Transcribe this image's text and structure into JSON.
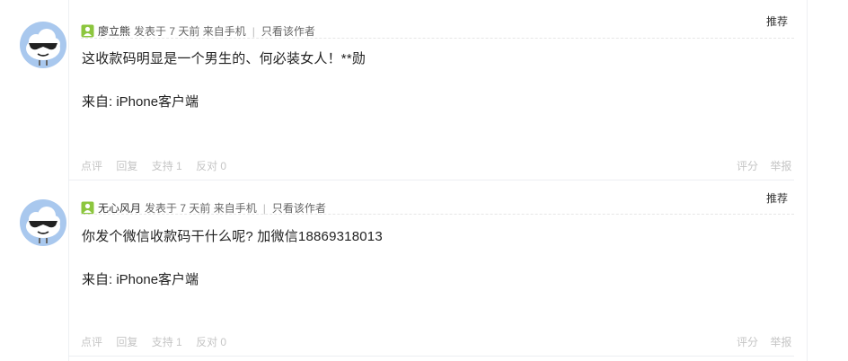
{
  "posts": [
    {
      "user": "廖立熊",
      "meta": "发表于 7 天前 来自手机",
      "only_author": "只看该作者",
      "badge": "推荐",
      "content": "这收款码明显是一个男生的、何必装女人！**勋",
      "from": "来自: iPhone客户端",
      "actions": {
        "comment": "点评",
        "reply": "回复",
        "support": "支持 1",
        "oppose": "反对 0",
        "rate": "评分",
        "report": "举报"
      }
    },
    {
      "user": "无心风月",
      "meta": "发表于 7 天前 来自手机",
      "only_author": "只看该作者",
      "badge": "推荐",
      "content": "你发个微信收款码干什么呢? 加微信18869318013",
      "from": "来自: iPhone客户端",
      "actions": {
        "comment": "点评",
        "reply": "回复",
        "support": "支持 1",
        "oppose": "反对 0",
        "rate": "评分",
        "report": "举报"
      }
    }
  ],
  "icons": {
    "avatar": "cloud-sunglasses-avatar-icon",
    "user": "online-user-icon"
  },
  "colors": {
    "user_icon": "#8cc63e",
    "avatar_bg": "#a9c8ee",
    "action_text": "#c5c5c5"
  }
}
